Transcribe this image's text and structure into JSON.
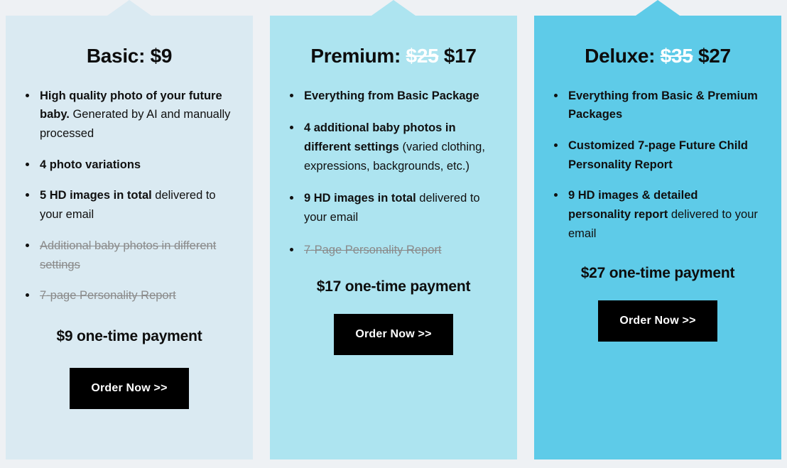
{
  "page": {
    "background_color": "#eef1f4"
  },
  "plans": [
    {
      "id": "basic",
      "title_prefix": "Basic: ",
      "old_price": "",
      "price": "$9",
      "background_color": "#daeaf2",
      "features": [
        {
          "lead": "High quality photo of your future baby.",
          "rest": " Generated by AI and manually processed",
          "struck": false
        },
        {
          "lead": "4 photo variations",
          "rest": "",
          "struck": false
        },
        {
          "lead": "5 HD images in total",
          "rest": " delivered to your email",
          "struck": false
        },
        {
          "lead": "",
          "rest": "Additional baby photos in different settings",
          "struck": true
        },
        {
          "lead": "",
          "rest": "7-page Personality Report",
          "struck": true
        }
      ],
      "payment": "$9 one-time payment",
      "button_label": "Order Now >>"
    },
    {
      "id": "premium",
      "title_prefix": "Premium: ",
      "old_price": "$25",
      "price": "$17",
      "background_color": "#ade4f0",
      "features": [
        {
          "lead": "Everything from Basic Package",
          "rest": "",
          "struck": false
        },
        {
          "lead": "4 additional baby photos in different settings",
          "rest": " (varied clothing, expressions, backgrounds, etc.)",
          "struck": false
        },
        {
          "lead": "9 HD images in total",
          "rest": " delivered to your email",
          "struck": false
        },
        {
          "lead": "",
          "rest": "7-Page Personality Report",
          "struck": true
        }
      ],
      "payment": "$17 one-time payment",
      "button_label": "Order Now >>"
    },
    {
      "id": "deluxe",
      "title_prefix": "Deluxe: ",
      "old_price": "$35",
      "price": "$27",
      "background_color": "#5ecbe8",
      "features": [
        {
          "lead": "Everything from Basic & Premium Packages",
          "rest": "",
          "struck": false
        },
        {
          "lead": "Customized 7-page Future Child Personality Report",
          "rest": "",
          "struck": false
        },
        {
          "lead": "9 HD images & detailed personality report",
          "rest": " delivered to your email",
          "struck": false
        }
      ],
      "payment": "$27 one-time payment",
      "button_label": "Order Now >>"
    }
  ]
}
